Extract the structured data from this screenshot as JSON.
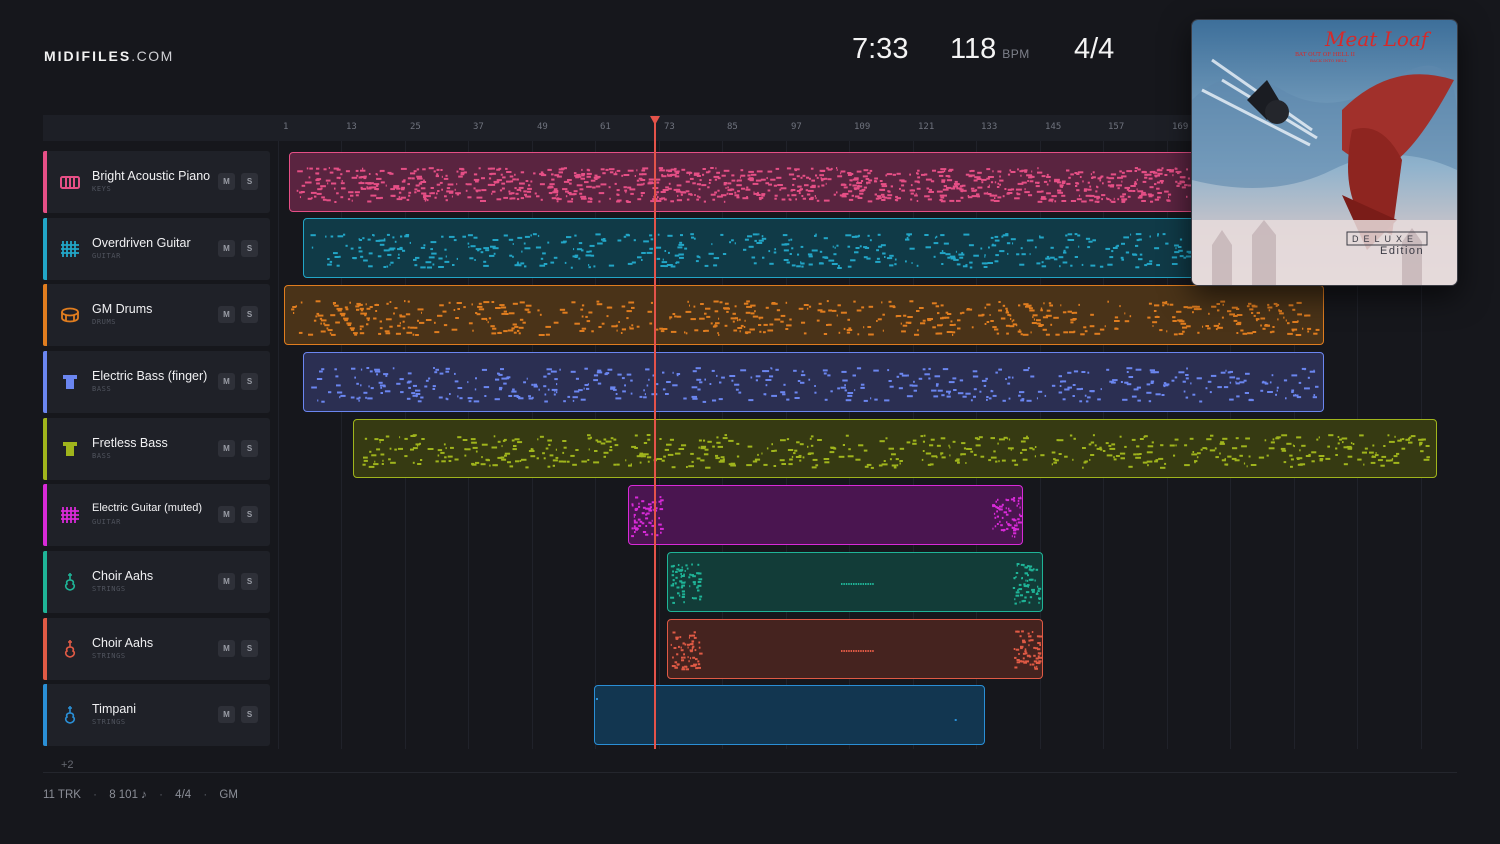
{
  "logo": {
    "brand": "MIDIFILES",
    "domain": ".COM"
  },
  "stats": {
    "duration": "7:33",
    "tempo": "118",
    "tempo_unit": "BPM",
    "time_signature": "4/4"
  },
  "ruler": {
    "ticks": [
      "1",
      "13",
      "25",
      "37",
      "49",
      "61",
      "73",
      "85",
      "97",
      "109",
      "121",
      "133",
      "145",
      "157",
      "169"
    ]
  },
  "tracks": [
    {
      "name": "Bright Acoustic Piano",
      "category": "KEYS",
      "color": "#e64f86",
      "icon": "piano-icon",
      "mute": "M",
      "solo": "S"
    },
    {
      "name": "Overdriven Guitar",
      "category": "GUITAR",
      "color": "#22a6c7",
      "icon": "guitar-fretboard-icon",
      "mute": "M",
      "solo": "S"
    },
    {
      "name": "GM Drums",
      "category": "DRUMS",
      "color": "#e07d1f",
      "icon": "drum-icon",
      "mute": "M",
      "solo": "S"
    },
    {
      "name": "Electric Bass (finger)",
      "category": "BASS",
      "color": "#6b86f0",
      "icon": "bass-icon",
      "mute": "M",
      "solo": "S"
    },
    {
      "name": "Fretless Bass",
      "category": "BASS",
      "color": "#a0b51c",
      "icon": "bass-icon",
      "mute": "M",
      "solo": "S"
    },
    {
      "name": "Electric Guitar (muted)",
      "category": "GUITAR",
      "color": "#d82ad8",
      "icon": "guitar-fretboard-icon",
      "mute": "M",
      "solo": "S"
    },
    {
      "name": "Choir Aahs",
      "category": "STRINGS",
      "color": "#1fb497",
      "icon": "violin-icon",
      "mute": "M",
      "solo": "S"
    },
    {
      "name": "Choir Aahs",
      "category": "STRINGS",
      "color": "#e05a45",
      "icon": "violin-icon",
      "mute": "M",
      "solo": "S"
    },
    {
      "name": "Timpani",
      "category": "STRINGS",
      "color": "#2a8fd6",
      "icon": "violin-icon",
      "mute": "M",
      "solo": "S"
    }
  ],
  "more_tracks": "+2",
  "footer": {
    "tracks": "11 TRK",
    "notes": "8 101 ♪",
    "time_signature": "4/4",
    "standard": "GM",
    "separator": "·"
  },
  "cover": {
    "artist": "Meat Loaf",
    "album": "BAT OUT OF HELL II",
    "subtitle": "BACK INTO HELL",
    "edition_word": "DELUXE",
    "edition_label": "Edition"
  }
}
